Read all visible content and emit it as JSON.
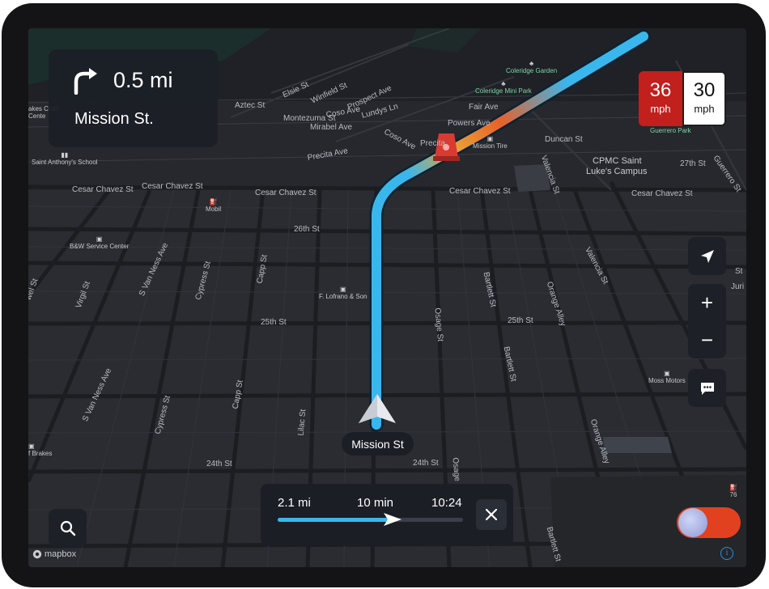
{
  "maneuver": {
    "icon": "turn-right-arrow-icon",
    "distance": "0.5 mi",
    "street": "Mission St."
  },
  "speed": {
    "current": "36",
    "current_unit": "mph",
    "limit": "30",
    "limit_unit": "mph"
  },
  "controls": {
    "recenter_icon": "navigation-arrow-icon",
    "zoom_in": "+",
    "zoom_out": "−",
    "feedback_icon": "chat-bubble-icon",
    "search_icon": "search-icon"
  },
  "current_street": "Mission St",
  "trip": {
    "distance": "2.1 mi",
    "duration": "10 min",
    "eta": "10:24",
    "progress": 0.62,
    "close_icon": "close-icon"
  },
  "attribution": "mapbox",
  "info_icon": "i",
  "colors": {
    "route_blue": "#39b7ec",
    "traffic_orange": "#e8612a",
    "speed_red": "#c1201d",
    "toggle_orange": "#e2411f",
    "map_bg": "#26282d"
  },
  "map_labels": {
    "aztec": "Aztec St",
    "elsie": "Elsie St",
    "winfield": "Winfield St",
    "prospect": "Prospect Ave",
    "coso": "Coso Ave",
    "coso2": "Coso Ave",
    "lundys": "Lundys Ln",
    "montezuma": "Montezuma St",
    "mirabel": "Mirabel Ave",
    "fair": "Fair Ave",
    "powers": "Powers Ave",
    "precita": "Precita Ave",
    "precita2": "Precita",
    "duncan": "Duncan St",
    "cpmc1": "CPMC Saint",
    "cpmc2": "Luke's Campus",
    "st27": "27th St",
    "guerrero": "Guerrero St",
    "guerrero_park": "Guerrero Park",
    "cesar1": "Cesar Chavez St",
    "cesar2": "Cesar Chavez St",
    "cesar3": "Cesar Chavez St",
    "cesar4": "Cesar Chavez St",
    "cesar5": "Cesar Chavez St",
    "st26": "26th St",
    "st25a": "25th St",
    "st25b": "25th St",
    "st24a": "24th St",
    "st24b": "24th St",
    "svanness1": "S Van Ness Ave",
    "svanness2": "S Van Ness Ave",
    "virgil": "Virgil St",
    "cypress1": "Cypress St",
    "cypress2": "Cypress St",
    "capp1": "Capp St",
    "capp2": "Capp St",
    "lilac": "Lilac St",
    "osage1": "Osage St",
    "osage2": "Osage St",
    "bartlett1": "Bartlett St",
    "bartlett2": "Bartlett St",
    "bartlett3": "Bartlett St",
    "orange1": "Orange Alley",
    "orange2": "Orange Alley",
    "valencia1": "Valencia St",
    "valencia2": "Valencia St",
    "juri": "Juri St",
    "st_edge": "St",
    "wel": "wel St"
  },
  "pois": {
    "coleridge": "Coleridge Mini Park",
    "coleridge_garden": "Coleridge Garden",
    "mission_tire": "Mission Tire",
    "lakes": "akes Child",
    "lakes2": "Cente",
    "saint_anthony": "Saint Anthony's School",
    "mobil": "Mobil",
    "bw": "B&W Service Center",
    "lofrano": "F. Lofrano & Son",
    "moss": "Moss Motors",
    "brakes": "f Brakes",
    "gas76": "76"
  }
}
